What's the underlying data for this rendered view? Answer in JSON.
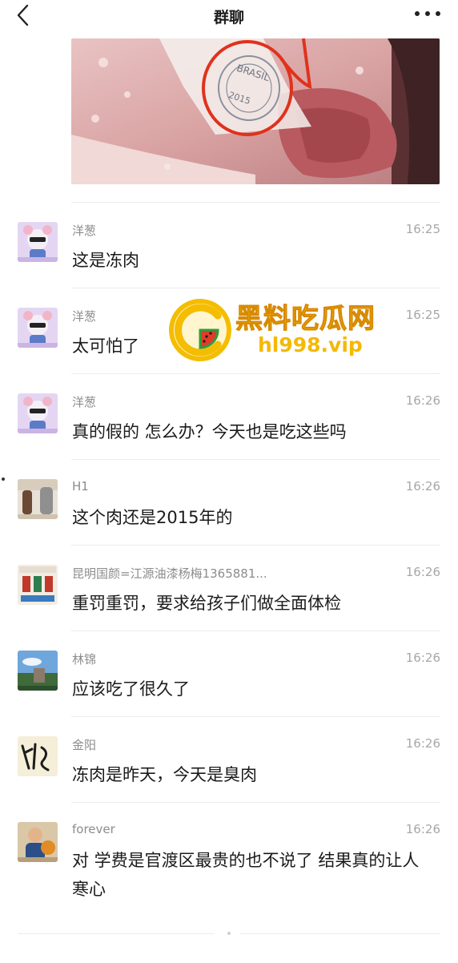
{
  "header": {
    "title": "群聊",
    "back_icon": "chevron-left-icon",
    "more_icon": "more-dots-icon"
  },
  "photo": {
    "stamp_text_1": "BRASIL",
    "stamp_text_2": "2015"
  },
  "watermark": {
    "title": "黑料吃瓜网",
    "url": "hl998.vip"
  },
  "messages": [
    {
      "nick": "洋葱",
      "time": "16:25",
      "text": "这是冻肉"
    },
    {
      "nick": "洋葱",
      "time": "16:25",
      "text": "太可怕了"
    },
    {
      "nick": "洋葱",
      "time": "16:26",
      "text": "真的假的  怎么办？今天也是吃这些吗"
    },
    {
      "nick": "H1",
      "time": "16:26",
      "text": "这个肉还是2015年的"
    },
    {
      "nick": "昆明国颜=江源油漆杨梅1365881...",
      "time": "16:26",
      "text": "重罚重罚，要求给孩子们做全面体检"
    },
    {
      "nick": "林锦",
      "time": "16:26",
      "text": "应该吃了很久了"
    },
    {
      "nick": "金阳",
      "time": "16:26",
      "text": "冻肉是昨天，今天是臭肉"
    },
    {
      "nick": "forever",
      "time": "16:26",
      "text": "对  学费是官渡区最贵的也不说了  结果真的让人寒心"
    }
  ]
}
